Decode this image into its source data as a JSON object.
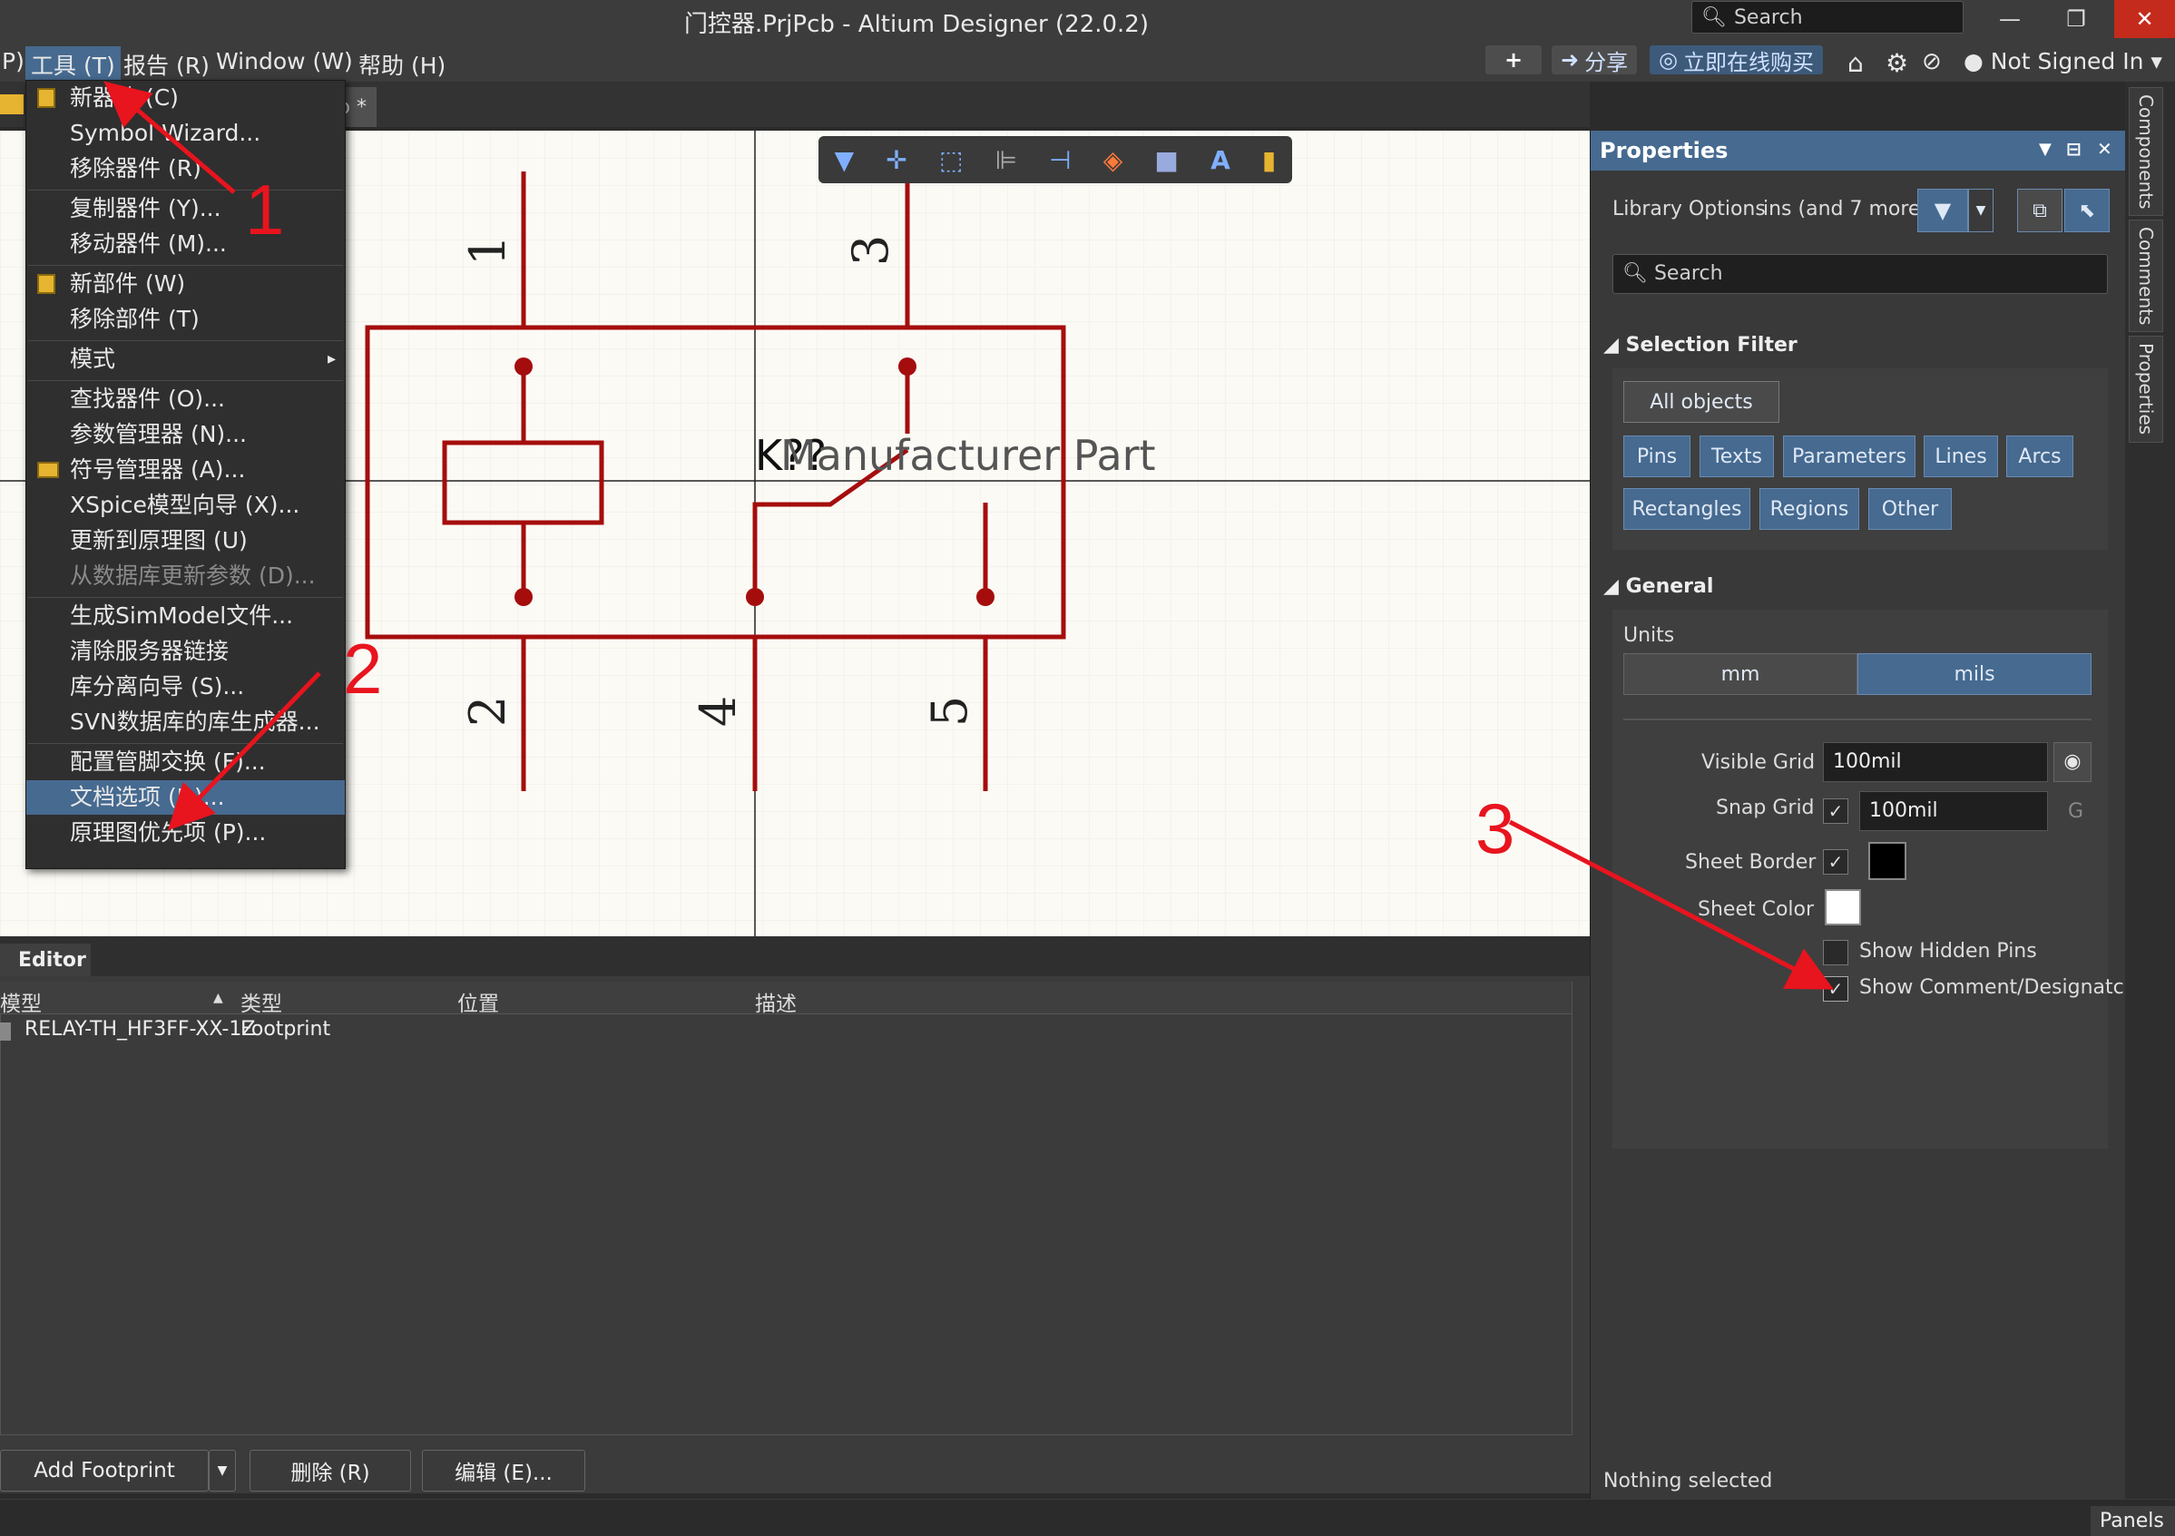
{
  "window": {
    "title": "门控器.PrjPcb - Altium Designer (22.0.2)",
    "search_placeholder": "Search",
    "min": "—",
    "max": "❐",
    "close": "✕"
  },
  "menubar": {
    "items": [
      "P)",
      "工具 (T)",
      "报告 (R)",
      "Window (W)",
      "帮助 (H)"
    ],
    "share": "分享",
    "buy": "立即在线购买",
    "user": "Not Signed In",
    "add_icon_label": "+"
  },
  "doc_tab": "b *",
  "tools_menu": {
    "items": [
      {
        "label": "新器件 (C)",
        "icon": "component-icon"
      },
      {
        "label": "Symbol Wizard..."
      },
      {
        "label": "移除器件 (R)"
      },
      {
        "label": "复制器件 (Y)..."
      },
      {
        "label": "移动器件 (M)..."
      },
      {
        "label": "新部件 (W)",
        "icon": "component-icon"
      },
      {
        "label": "移除部件 (T)"
      },
      {
        "label": "模式"
      },
      {
        "label": "查找器件 (O)..."
      },
      {
        "label": "参数管理器 (N)..."
      },
      {
        "label": "符号管理器 (A)...",
        "icon": "folder-icon"
      },
      {
        "label": "XSpice模型向导 (X)..."
      },
      {
        "label": "更新到原理图 (U)"
      },
      {
        "label": "从数据库更新参数 (D)...",
        "disabled": true
      },
      {
        "label": "生成SimModel文件..."
      },
      {
        "label": "清除服务器链接"
      },
      {
        "label": "库分离向导 (S)..."
      },
      {
        "label": "SVN数据库的库生成器..."
      },
      {
        "label": "配置管脚交换 (F)..."
      },
      {
        "label": "文档选项 (D)...",
        "highlighted": true
      },
      {
        "label": "原理图优先项 (P)..."
      }
    ],
    "submenu_arrow": "▸"
  },
  "annotations": {
    "n1": "1",
    "n2": "2",
    "n3": "3"
  },
  "schematic": {
    "designator": "K??",
    "comment": "Manufacturer Part",
    "pins": [
      "1",
      "2",
      "3",
      "4",
      "5"
    ]
  },
  "editor": {
    "tab": "Editor",
    "columns": [
      "模型",
      "类型",
      "位置",
      "描述"
    ],
    "sort_glyph": "▲",
    "rows": [
      {
        "model": "RELAY-TH_HF3FF-XX-1Z",
        "type": "Footprint",
        "location": "",
        "description": ""
      }
    ],
    "add_footprint": "Add Footprint",
    "dropdown": "▼",
    "delete": "删除 (R)",
    "edit": "编辑 (E)..."
  },
  "properties": {
    "title": "Properties",
    "header_icons": [
      "▼",
      "⊟",
      "✕"
    ],
    "library_options": "Library Options",
    "library_more": "ins (and 7 more)",
    "search_placeholder": "Search",
    "selection_filter": {
      "title": "Selection Filter",
      "all": "All objects",
      "buttons": [
        "Pins",
        "Texts",
        "Parameters",
        "Lines",
        "Arcs",
        "Rectangles",
        "Regions",
        "Other"
      ]
    },
    "general": {
      "title": "General",
      "units_label": "Units",
      "units": [
        "mm",
        "mils"
      ],
      "units_selected": "mils",
      "visible_grid_label": "Visible Grid",
      "visible_grid": "100mil",
      "snap_grid_label": "Snap Grid",
      "snap_grid": "100mil",
      "snap_grid_suffix": "G",
      "sheet_border_label": "Sheet Border",
      "sheet_color_label": "Sheet Color",
      "show_hidden_pins": "Show Hidden Pins",
      "show_comment": "Show Comment/Designatc",
      "check": "✓"
    },
    "footer": "Nothing selected"
  },
  "side_tabs": [
    "Components",
    "Comments",
    "Properties"
  ],
  "status": {
    "panels": "Panels"
  },
  "colors": {
    "accent": "#466a90",
    "schematic": "#a50d0d",
    "annotation": "#e8141e"
  }
}
